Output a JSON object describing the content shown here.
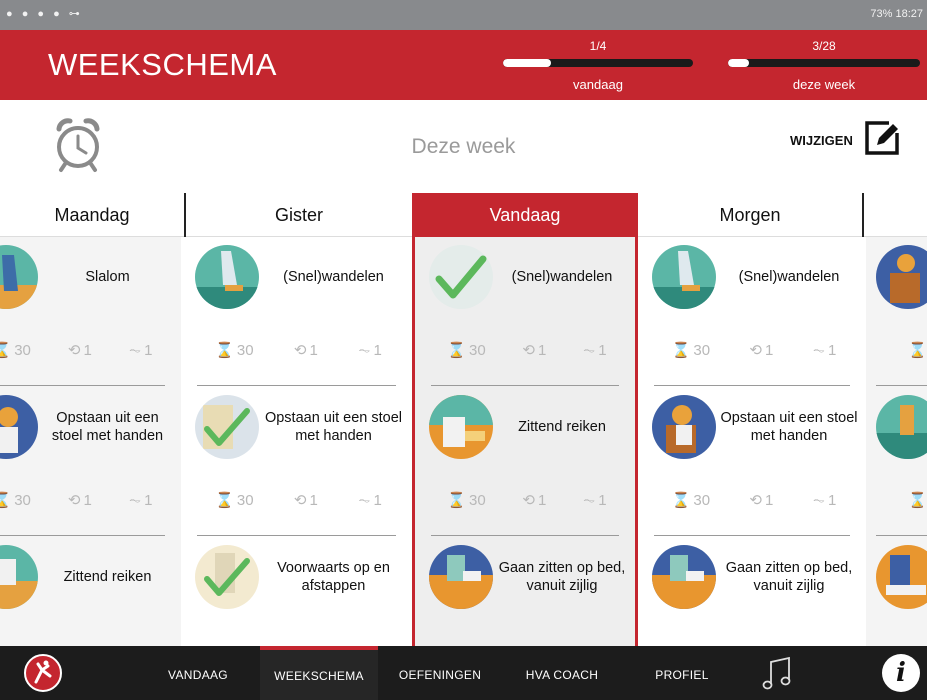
{
  "status_bar": {
    "left_icons": "● ● ● ● ⊶",
    "right_text": "73% 18:27"
  },
  "header": {
    "title": "WEEKSCHEMA",
    "progress_today": {
      "fraction": "1/4",
      "caption": "vandaag",
      "value": 0.25
    },
    "progress_week": {
      "fraction": "3/28",
      "caption": "deze week",
      "value": 0.107
    }
  },
  "toolbar": {
    "week_label": "Deze week",
    "edit_label": "WIJZIGEN",
    "alarm_icon": "alarm-clock-icon",
    "edit_icon": "edit-icon"
  },
  "days": [
    {
      "label": "Maandag"
    },
    {
      "label": "Gister"
    },
    {
      "label": "Vandaag"
    },
    {
      "label": "Morgen"
    }
  ],
  "columns": [
    {
      "exercises": [
        {
          "name": "Slalom",
          "stats": {
            "time": "30",
            "reps": "1",
            "intensity": "1"
          }
        },
        {
          "name": "Opstaan uit een stoel met handen",
          "stats": {
            "time": "30",
            "reps": "1",
            "intensity": "1"
          }
        },
        {
          "name": "Zittend reiken"
        }
      ]
    },
    {
      "exercises": [
        {
          "name": "(Snel)wandelen",
          "stats": {
            "time": "30",
            "reps": "1",
            "intensity": "1"
          }
        },
        {
          "name": "Opstaan uit een stoel met handen",
          "done": true,
          "stats": {
            "time": "30",
            "reps": "1",
            "intensity": "1"
          }
        },
        {
          "name": "Voorwaarts op en afstappen",
          "done": true
        }
      ]
    },
    {
      "exercises": [
        {
          "name": "(Snel)wandelen",
          "done": true,
          "stats": {
            "time": "30",
            "reps": "1",
            "intensity": "1"
          }
        },
        {
          "name": "Zittend reiken",
          "stats": {
            "time": "30",
            "reps": "1",
            "intensity": "1"
          }
        },
        {
          "name": "Gaan zitten op bed, vanuit zijlig"
        }
      ]
    },
    {
      "exercises": [
        {
          "name": "(Snel)wandelen",
          "stats": {
            "time": "30",
            "reps": "1",
            "intensity": "1"
          }
        },
        {
          "name": "Opstaan uit een stoel met handen",
          "stats": {
            "time": "30",
            "reps": "1",
            "intensity": "1"
          }
        },
        {
          "name": "Gaan zitten op bed, vanuit zijlig"
        }
      ]
    }
  ],
  "bottom_nav": {
    "items": [
      {
        "label": "VANDAAG"
      },
      {
        "label": "WEEKSCHEMA",
        "active": true
      },
      {
        "label": "OEFENINGEN"
      },
      {
        "label": "HVA COACH"
      },
      {
        "label": "PROFIEL"
      }
    ],
    "info_label": "i"
  },
  "colors": {
    "brand_red": "#c4262f",
    "check_green": "#5cb85c",
    "nav_bg": "#1c1c1c"
  }
}
